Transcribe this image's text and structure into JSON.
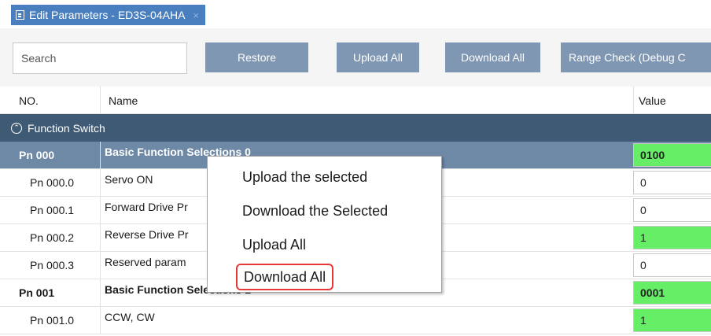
{
  "tab": {
    "title": "Edit Parameters - ED3S-04AHA",
    "close_glyph": "×",
    "icon": "document-icon"
  },
  "toolbar": {
    "search_placeholder": "Search",
    "restore_label": "Restore",
    "upload_all_label": "Upload All",
    "download_all_label": "Download All",
    "range_check_label": "Range Check (Debug C"
  },
  "columns": {
    "no": "NO.",
    "name": "Name",
    "value": "Value"
  },
  "group": {
    "label": "Function Switch",
    "icon": "chevron-up-circle-icon"
  },
  "rows": [
    {
      "no": "Pn 000",
      "name": "Basic Function Selections 0",
      "value": "0100",
      "level": "parent",
      "selected": true,
      "value_color": "#66ee66"
    },
    {
      "no": "Pn 000.0",
      "name": "Servo ON",
      "value": "0",
      "level": "child",
      "selected": false,
      "value_color": "#ffffff"
    },
    {
      "no": "Pn 000.1",
      "name": "Forward Drive Pr",
      "value": "0",
      "level": "child",
      "selected": false,
      "value_color": "#ffffff"
    },
    {
      "no": "Pn 000.2",
      "name": "Reverse Drive Pr",
      "value": "1",
      "level": "child",
      "selected": false,
      "value_color": "#66ee66"
    },
    {
      "no": "Pn 000.3",
      "name": "Reserved param",
      "value": "0",
      "level": "child",
      "selected": false,
      "value_color": "#ffffff"
    },
    {
      "no": "Pn 001",
      "name": "Basic Function Selections 1",
      "value": "0001",
      "level": "parent",
      "selected": false,
      "value_color": "#66ee66"
    },
    {
      "no": "Pn 001.0",
      "name": "CCW, CW",
      "value": "1",
      "level": "child",
      "selected": false,
      "value_color": "#66ee66"
    }
  ],
  "context_menu": {
    "items": [
      {
        "label": "Upload the selected"
      },
      {
        "label": "Download the Selected"
      },
      {
        "label": "Upload All"
      },
      {
        "label": "Download All",
        "highlighted": true
      }
    ]
  },
  "colors": {
    "tab_active": "#4a7fbf",
    "toolbar_button": "#7f97b3",
    "group_header": "#3f5a75",
    "selected_row": "#6e89a6",
    "value_ok": "#66ee66",
    "highlight_box": "#e53935"
  }
}
